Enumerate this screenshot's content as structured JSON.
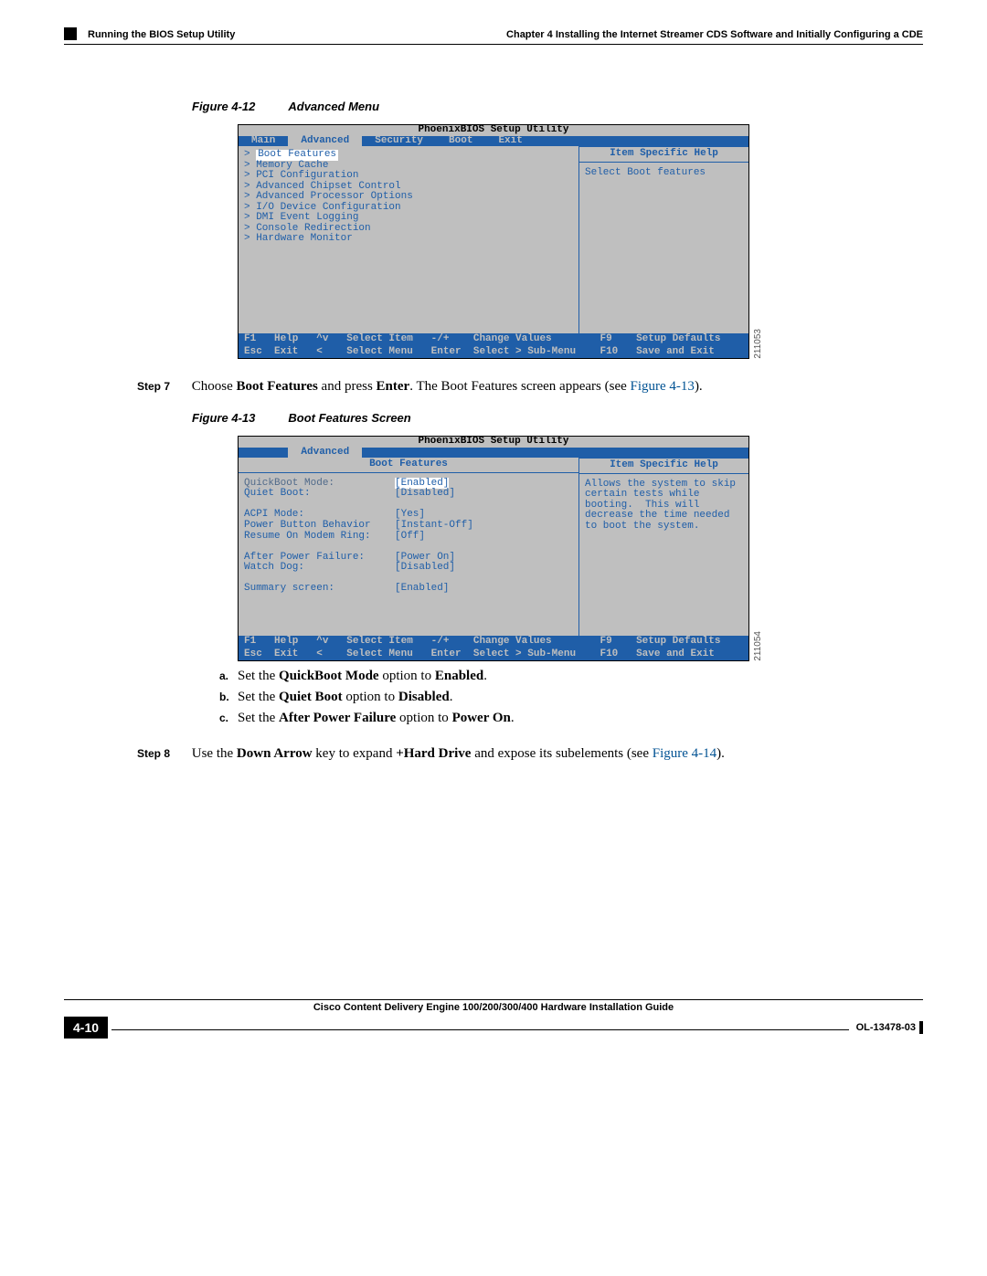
{
  "header": {
    "chapter": "Chapter 4      Installing the Internet Streamer CDS Software and Initially Configuring a CDE",
    "running": "Running the BIOS Setup Utility"
  },
  "fig12": {
    "label": "Figure 4-12",
    "title": "Advanced Menu",
    "bios_title": "PhoenixBIOS Setup Utility",
    "tabs": [
      "Main",
      "Advanced",
      "Security",
      "Boot",
      "Exit"
    ],
    "active_tab": "Advanced",
    "menu_items": [
      "Boot Features",
      "Memory Cache",
      "PCI Configuration",
      "Advanced Chipset Control",
      "Advanced Processor Options",
      "I/O Device Configuration",
      "DMI Event Logging",
      "Console Redirection",
      "Hardware Monitor"
    ],
    "help_title": "Item Specific Help",
    "help_text": "Select Boot features",
    "foot1": "F1   Help   ^v   Select Item   -/+    Change Values        F9    Setup Defaults",
    "foot2": "Esc  Exit   <    Select Menu   Enter  Select > Sub-Menu    F10   Save and Exit",
    "side_num": "211053"
  },
  "step7": {
    "label": "Step 7",
    "pre": "Choose ",
    "b1": "Boot Features",
    "mid": " and press ",
    "b2": "Enter",
    "post": ". The Boot Features screen appears (see ",
    "xref": "Figure 4-13",
    "end": ")."
  },
  "fig13": {
    "label": "Figure 4-13",
    "title": "Boot Features Screen",
    "bios_title": "PhoenixBIOS Setup Utility",
    "tab": "Advanced",
    "panel_title": "Boot Features",
    "rows": [
      {
        "k": "QuickBoot Mode:",
        "v": "[Enabled]",
        "hl": true,
        "dim": true
      },
      {
        "k": "Quiet Boot:",
        "v": "[Disabled]"
      },
      {
        "k": "",
        "v": ""
      },
      {
        "k": "ACPI Mode:",
        "v": "[Yes]"
      },
      {
        "k": "Power Button Behavior",
        "v": "[Instant-Off]"
      },
      {
        "k": "Resume On Modem Ring:",
        "v": "[Off]"
      },
      {
        "k": "",
        "v": ""
      },
      {
        "k": "After Power Failure:",
        "v": "[Power On]"
      },
      {
        "k": "Watch Dog:",
        "v": "[Disabled]"
      },
      {
        "k": "",
        "v": ""
      },
      {
        "k": "Summary screen:",
        "v": "[Enabled]"
      }
    ],
    "help_title": "Item Specific Help",
    "help_text": "Allows the system to skip certain tests while booting.  This will decrease the time needed to boot the system.",
    "foot1": "F1   Help   ^v   Select Item   -/+    Change Values        F9    Setup Defaults",
    "foot2": "Esc  Exit   <    Select Menu   Enter  Select > Sub-Menu    F10   Save and Exit",
    "side_num": "211054"
  },
  "sublist": {
    "a": {
      "pre": "Set the ",
      "b1": "QuickBoot Mode",
      "mid": " option to ",
      "b2": "Enabled",
      "end": "."
    },
    "b": {
      "pre": "Set the ",
      "b1": "Quiet Boot",
      "mid": " option to ",
      "b2": "Disabled",
      "end": "."
    },
    "c": {
      "pre": "Set the ",
      "b1": "After Power Failure",
      "mid": " option to ",
      "b2": "Power On",
      "end": "."
    }
  },
  "step8": {
    "label": "Step 8",
    "pre": "Use the ",
    "b1": "Down Arrow",
    "mid1": " key to expand ",
    "b2": "+Hard Drive",
    "mid2": " and expose its subelements (see ",
    "xref": "Figure 4-14",
    "end": ")."
  },
  "footer": {
    "guide": "Cisco Content Delivery Engine 100/200/300/400 Hardware Installation Guide",
    "page": "4-10",
    "doc": "OL-13478-03"
  }
}
